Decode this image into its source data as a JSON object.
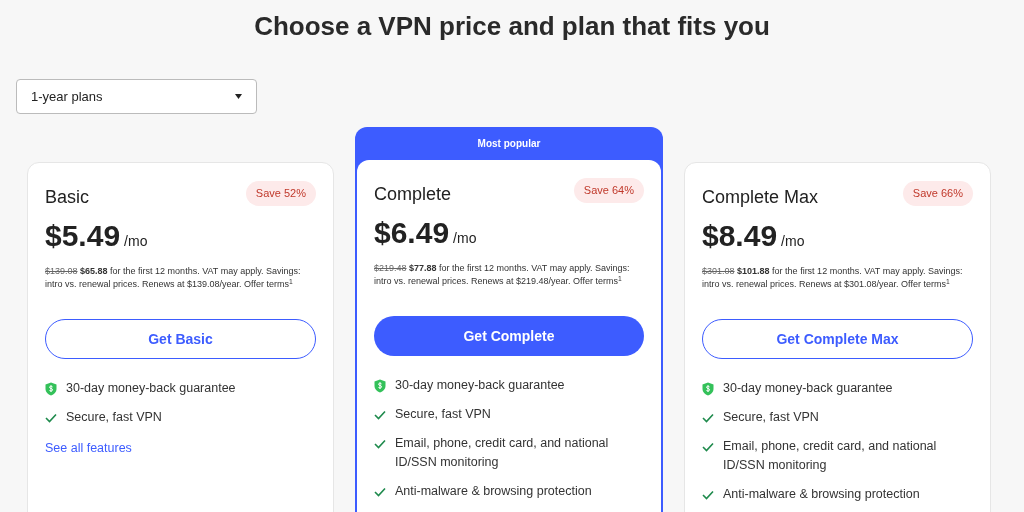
{
  "heading": "Choose a VPN price and plan that fits you",
  "plan_select": {
    "value": "1-year plans"
  },
  "plans": [
    {
      "name": "Basic",
      "featured": false,
      "save": "Save 52%",
      "price": "$5.49",
      "unit": "/mo",
      "old_price": "$139.08",
      "note": "**$65.88** for the first 12 months. VAT may apply. Savings: intro vs. renewal prices. Renews at $139.08/year. Offer terms$^{1}$",
      "button": "Get Basic",
      "features": [
        {
          "kind": "guarantee",
          "text": "30-day money-back guarantee"
        },
        {
          "kind": "check",
          "text": "Secure, fast VPN"
        }
      ],
      "link": "See all features"
    },
    {
      "name": "Complete",
      "featured": true,
      "banner": "Most popular",
      "save": "Save 64%",
      "price": "$6.49",
      "unit": "/mo",
      "old_price": "$219.48",
      "note": "**$77.88** for the first 12 months. VAT may apply. Savings: intro vs. renewal prices. Renews at $219.48/year. Offer terms$^{1}$",
      "button": "Get Complete",
      "features": [
        {
          "kind": "guarantee",
          "text": "30-day money-back guarantee"
        },
        {
          "kind": "check",
          "text": "Secure, fast VPN"
        },
        {
          "kind": "check",
          "text": "Email, phone, credit card, and national ID/SSN monitoring"
        },
        {
          "kind": "check",
          "text": "Anti-malware & browsing protection"
        }
      ]
    },
    {
      "name": "Complete Max",
      "featured": false,
      "save": "Save 66%",
      "price": "$8.49",
      "unit": "/mo",
      "old_price": "$301.08",
      "note": "**$101.88** for the first 12 months. VAT may apply. Savings: intro vs. renewal prices. Renews at $301.08/year. Offer terms$^{1}$",
      "button": "Get Complete Max",
      "features": [
        {
          "kind": "guarantee",
          "text": "30-day money-back guarantee"
        },
        {
          "kind": "check",
          "text": "Secure, fast VPN"
        },
        {
          "kind": "check",
          "text": "Email, phone, credit card, and national ID/SSN monitoring"
        },
        {
          "kind": "check",
          "text": "Anti-malware & browsing protection"
        }
      ]
    }
  ]
}
